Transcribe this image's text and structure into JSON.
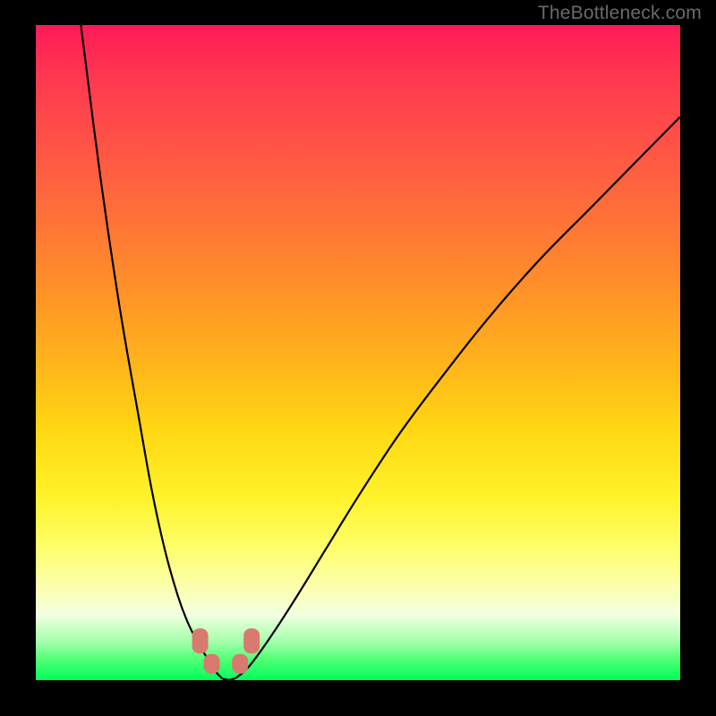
{
  "watermark": "TheBottleneck.com",
  "chart_data": {
    "type": "line",
    "title": "",
    "xlabel": "",
    "ylabel": "",
    "xlim": [
      0,
      100
    ],
    "ylim": [
      0,
      100
    ],
    "grid": false,
    "series": [
      {
        "name": "left-branch",
        "x": [
          7,
          10,
          13,
          16,
          18,
          20,
          22,
          23.5,
          25,
          26.2,
          27.2,
          28,
          29
        ],
        "y": [
          100,
          77,
          57,
          40,
          29,
          20,
          13,
          9,
          6,
          4,
          2.5,
          1.2,
          0.2
        ]
      },
      {
        "name": "right-branch",
        "x": [
          31,
          33,
          36,
          40,
          45,
          50,
          56,
          62,
          70,
          78,
          86,
          94,
          100
        ],
        "y": [
          0.3,
          2,
          6,
          12,
          20,
          28,
          37,
          45,
          55,
          64,
          72,
          80,
          86
        ]
      }
    ],
    "markers": [
      {
        "x": 25.5,
        "y": 6,
        "name": "marker-left-upper"
      },
      {
        "x": 27.3,
        "y": 2.5,
        "name": "marker-left-lower"
      },
      {
        "x": 31.7,
        "y": 2.5,
        "name": "marker-right-lower"
      },
      {
        "x": 33.5,
        "y": 6,
        "name": "marker-right-upper"
      }
    ],
    "colors": {
      "curve": "#000000",
      "marker": "#d87a6f",
      "background_top": "#ff1a57",
      "background_bottom": "#00ff5c"
    }
  }
}
